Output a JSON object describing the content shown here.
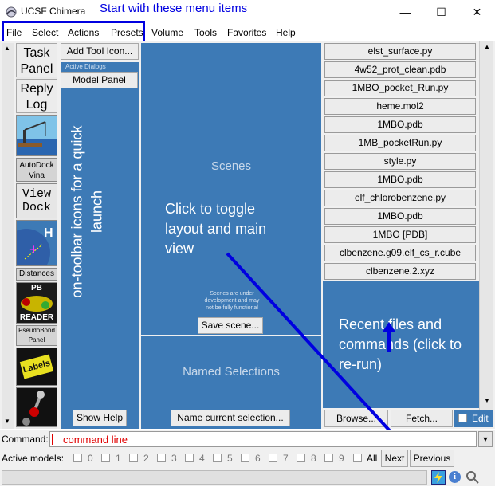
{
  "window": {
    "title": "UCSF Chimera",
    "controls": [
      "—",
      "☐",
      "✕"
    ]
  },
  "annotations": {
    "top_note": "Start with these menu items",
    "toolbar_note": "on-toolbar icons for a quick launch",
    "toggle_note": "Click to toggle layout and main view",
    "recent_note": "Recent files and commands (click to re-run)",
    "command_note": "command line"
  },
  "menubar": {
    "items": [
      "File",
      "Select",
      "Actions",
      "Presets",
      "Volume",
      "Tools",
      "Favorites",
      "Help"
    ]
  },
  "toolbar": {
    "task_panel": "Task Panel",
    "reply_log": "Reply Log",
    "autodock_label": "AutoDock Vina",
    "viewdock_label": "View Dock",
    "distances_label": "Distances",
    "pb_reader_top": "PB",
    "pb_reader_bottom": "READER",
    "pseudobond_label": "PseudoBond Panel",
    "labels_label": "Labels"
  },
  "dialogs": {
    "add_tool_icon": "Add Tool Icon...",
    "active_dialogs": "Active Dialogs",
    "model_panel": "Model Panel",
    "show_help": "Show Help"
  },
  "scenes": {
    "title": "Scenes",
    "note": "Scenes are under development and may not be fully functional",
    "save_button": "Save scene..."
  },
  "named_selections": {
    "title": "Named Selections",
    "button": "Name current selection..."
  },
  "recent": {
    "items": [
      "elst_surface.py",
      "4w52_prot_clean.pdb",
      "1MBO_pocket_Run.py",
      "heme.mol2",
      "1MBO.pdb",
      "1MB_pocketRun.py",
      "style.py",
      "1MBO.pdb",
      "elf_chlorobenzene.py",
      "1MBO.pdb",
      "1MBO [PDB]",
      "clbenzene.g09.elf_cs_r.cube",
      "clbenzene.2.xyz"
    ],
    "browse_button": "Browse...",
    "fetch_button": "Fetch...",
    "edit_label": "Edit"
  },
  "command": {
    "label": "Command:"
  },
  "active_models": {
    "label": "Active models:",
    "models": [
      "0",
      "1",
      "2",
      "3",
      "4",
      "5",
      "6",
      "7",
      "8",
      "9"
    ],
    "all_label": "All",
    "next_button": "Next",
    "previous_button": "Previous"
  },
  "colors": {
    "accent_blue": "#0000e0",
    "panel_blue": "#3d7ab6",
    "command_red": "#e00000"
  }
}
